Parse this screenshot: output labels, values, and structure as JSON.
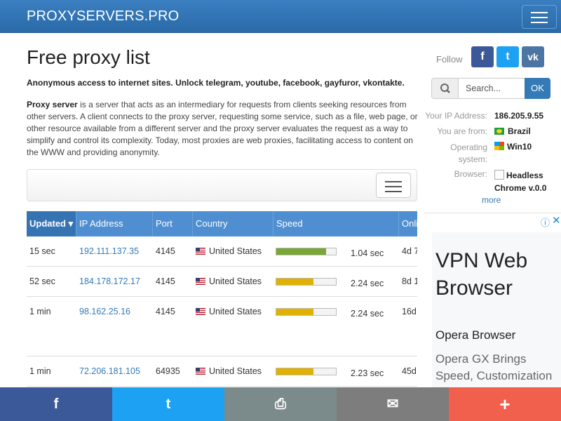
{
  "header": {
    "brand": "PROXYSERVERS.PRO"
  },
  "page": {
    "title": "Free proxy list",
    "tagline": "Anonymous access to internet sites. Unlock telegram, youtube, facebook, gayfuror, vkontakte.",
    "intro_term": "Proxy server",
    "intro_text": " is a server that acts as an intermediary for requests from clients seeking resources from other servers. A client connects to the proxy server, requesting some service, such as a file, web page, or other resource available from a different server and the proxy server evaluates the request as a way to simplify and control its complexity. Today, most proxies are web proxies, facilitating access to content on the WWW and providing anonymity."
  },
  "table": {
    "columns": [
      "Updated ▾",
      "IP Address",
      "Port",
      "Country",
      "Speed",
      "Onli"
    ],
    "rows": [
      {
        "updated": "15 sec",
        "ip": "192.111.137.35",
        "port": "4145",
        "country": "United States",
        "speed": "1.04 sec",
        "speed_fraction": 0.84,
        "speed_color": "green",
        "online": "4d 7"
      },
      {
        "updated": "52 sec",
        "ip": "184.178.172.17",
        "port": "4145",
        "country": "United States",
        "speed": "2.24 sec",
        "speed_fraction": 0.62,
        "speed_color": "yellow",
        "online": "8d 1"
      },
      {
        "updated": "1 min",
        "ip": "98.162.25.16",
        "port": "4145",
        "country": "United States",
        "speed": "2.24 sec",
        "speed_fraction": 0.62,
        "speed_color": "yellow",
        "online": "16d"
      },
      {
        "updated": "1 min",
        "ip": "72.206.181.105",
        "port": "64935",
        "country": "United States",
        "speed": "2.23 sec",
        "speed_fraction": 0.62,
        "speed_color": "yellow",
        "online": "45d"
      }
    ]
  },
  "sidebar": {
    "follow": "Follow",
    "social": [
      "f",
      "t",
      "vk"
    ],
    "search_placeholder": "Search...",
    "search_button": "OK",
    "ip_label": "Your IP Address:",
    "ip_value": "186.205.9.55",
    "from_label": "You are from:",
    "from_value": "Brazil",
    "os_label": "Operating system:",
    "os_value": "Win10",
    "browser_label": "Browser:",
    "browser_value": "Headless Chrome v.0.0",
    "more": "more"
  },
  "ad": {
    "title": "VPN Web Browser",
    "subtitle": "Opera Browser",
    "body": "Opera GX Brings Speed, Customization"
  },
  "share": {
    "facebook": "f",
    "twitter": "t",
    "print": "⎙",
    "email": "✉",
    "more": "+"
  },
  "colors": {
    "header": "#2a6aa8",
    "table_header": "#4f8fd1",
    "facebook": "#3b5998",
    "twitter": "#1da1f2",
    "vk": "#4c75a3",
    "print": "#7b8a8b",
    "email": "#7d7d7d",
    "more": "#f0604d"
  }
}
